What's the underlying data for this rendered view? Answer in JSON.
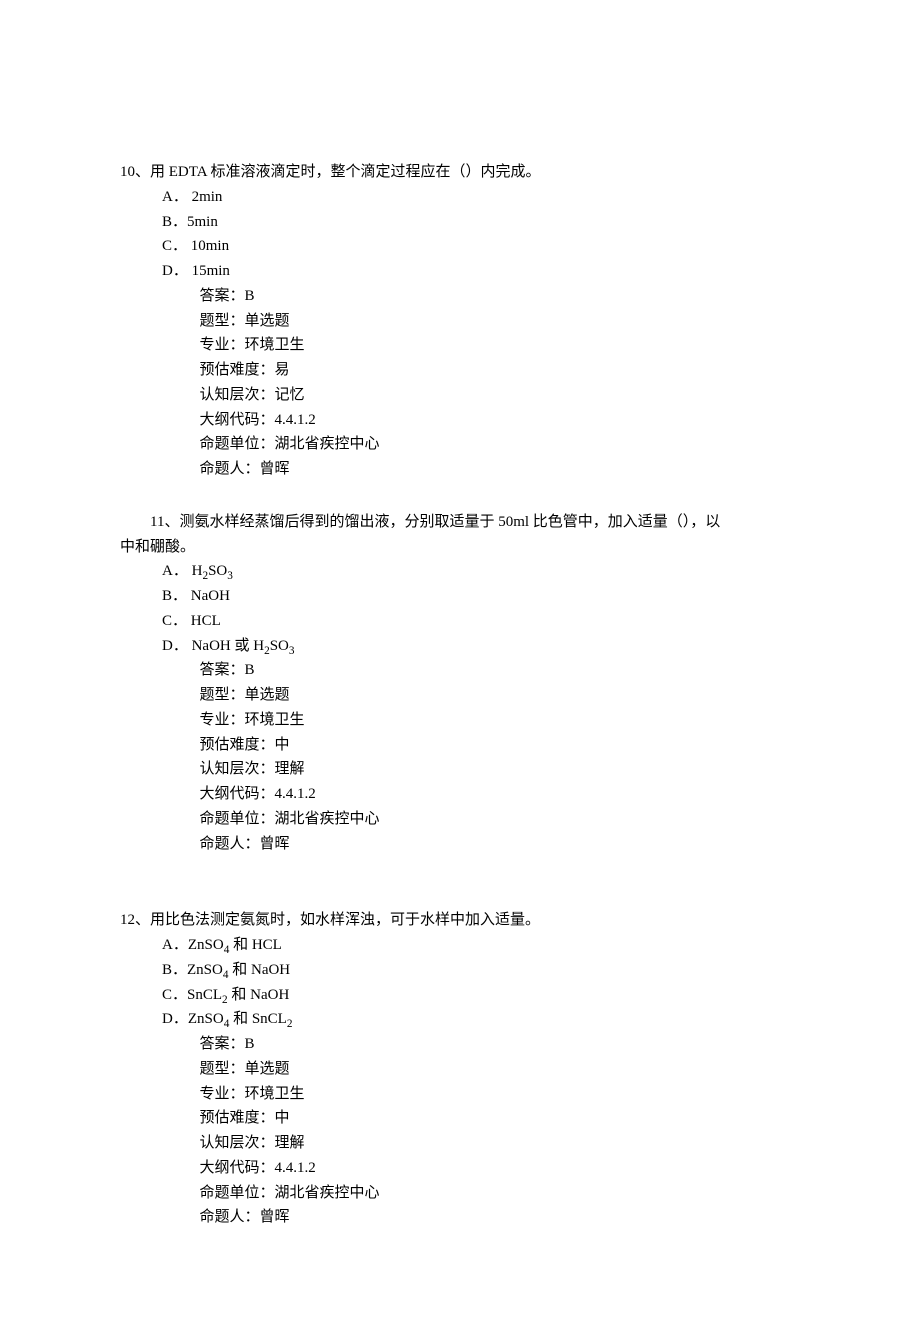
{
  "questions": [
    {
      "number": "10",
      "stem": "用 EDTA 标准溶液滴定时，整个滴定过程应在（）内完成。",
      "stem_indented": false,
      "continuation": "",
      "options": [
        {
          "label": "A．",
          "text": " 2min"
        },
        {
          "label": "B．",
          "text": "5min"
        },
        {
          "label": "C．",
          "text": " 10min"
        },
        {
          "label": "D．",
          "text": " 15min"
        }
      ],
      "meta": {
        "answer": "答案：B",
        "type": "题型：单选题",
        "subject": "专业：环境卫生",
        "difficulty": "预估难度：易",
        "cognition": "认知层次：记忆",
        "code": "大纲代码：4.4.1.2",
        "unit": "命题单位：湖北省疾控中心",
        "author": "命题人：曾晖"
      }
    },
    {
      "number": "11",
      "stem": "测氨水样经蒸馏后得到的馏出液，分别取适量于 50ml 比色管中，加入适量（），以",
      "stem_indented": true,
      "continuation": "中和硼酸。",
      "options": [
        {
          "label": "A．",
          "text": " H",
          "sub1": "2",
          "text2": "SO",
          "sub2": "3"
        },
        {
          "label": " B．",
          "text": " NaOH"
        },
        {
          "label": "C．",
          "text": " HCL"
        },
        {
          "label": "D．",
          "text": " NaOH 或 H",
          "sub1": "2",
          "text2": "SO",
          "sub2": "3"
        }
      ],
      "meta": {
        "answer": "答案：B",
        "type": "题型：单选题",
        "subject": "专业：环境卫生",
        "difficulty": "预估难度：中",
        "cognition": "认知层次：理解",
        "code": "大纲代码：4.4.1.2",
        "unit": "命题单位：湖北省疾控中心",
        "author": "命题人：曾晖"
      }
    },
    {
      "number": "12",
      "stem": "用比色法测定氨氮时，如水样浑浊，可于水样中加入适量。",
      "stem_indented": false,
      "continuation": "",
      "options": [
        {
          "label": "A．",
          "text": "ZnSO",
          "sub1": "4",
          "text2": " 和 HCL"
        },
        {
          "label": "B．",
          "text": "ZnSO",
          "sub1": "4",
          "text2": " 和 NaOH"
        },
        {
          "label": "C．",
          "text": "SnCL",
          "sub1": "2",
          "text2": " 和 NaOH"
        },
        {
          "label": "D．",
          "text": "ZnSO",
          "sub1": "4",
          "text2": " 和 SnCL",
          "sub2": "2"
        }
      ],
      "meta": {
        "answer": "答案：B",
        "type": "题型：单选题",
        "subject": "专业：环境卫生",
        "difficulty": "预估难度：中",
        "cognition": "认知层次：理解",
        "code": "大纲代码：4.4.1.2",
        "unit": "命题单位：湖北省疾控中心",
        "author": "命题人：曾晖"
      }
    }
  ]
}
